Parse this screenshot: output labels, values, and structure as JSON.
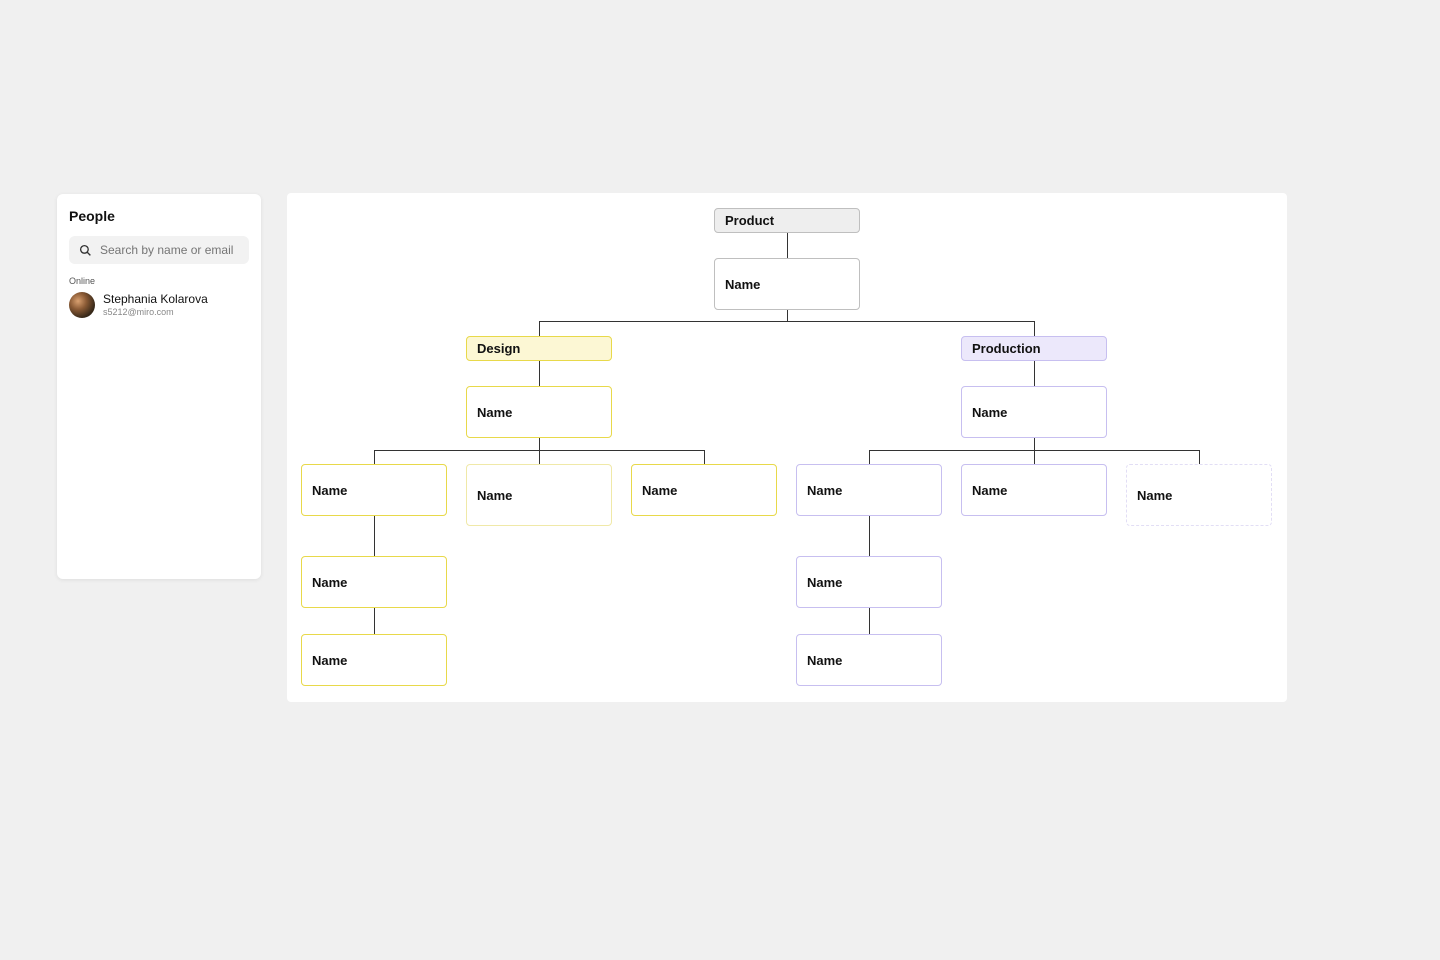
{
  "sidebar": {
    "title": "People",
    "search_placeholder": "Search by name or email",
    "online_label": "Online",
    "person": {
      "name": "Stephania Kolarova",
      "email": "s5212@miro.com"
    }
  },
  "chart": {
    "root": "Product",
    "root_name": "Name",
    "left": {
      "header": "Design",
      "lead": "Name",
      "children": [
        "Name",
        "Name",
        "Name"
      ],
      "subchain": [
        "Name",
        "Name"
      ]
    },
    "right": {
      "header": "Production",
      "lead": "Name",
      "children": [
        "Name",
        "Name",
        "Name"
      ],
      "subchain": [
        "Name",
        "Name"
      ]
    }
  }
}
